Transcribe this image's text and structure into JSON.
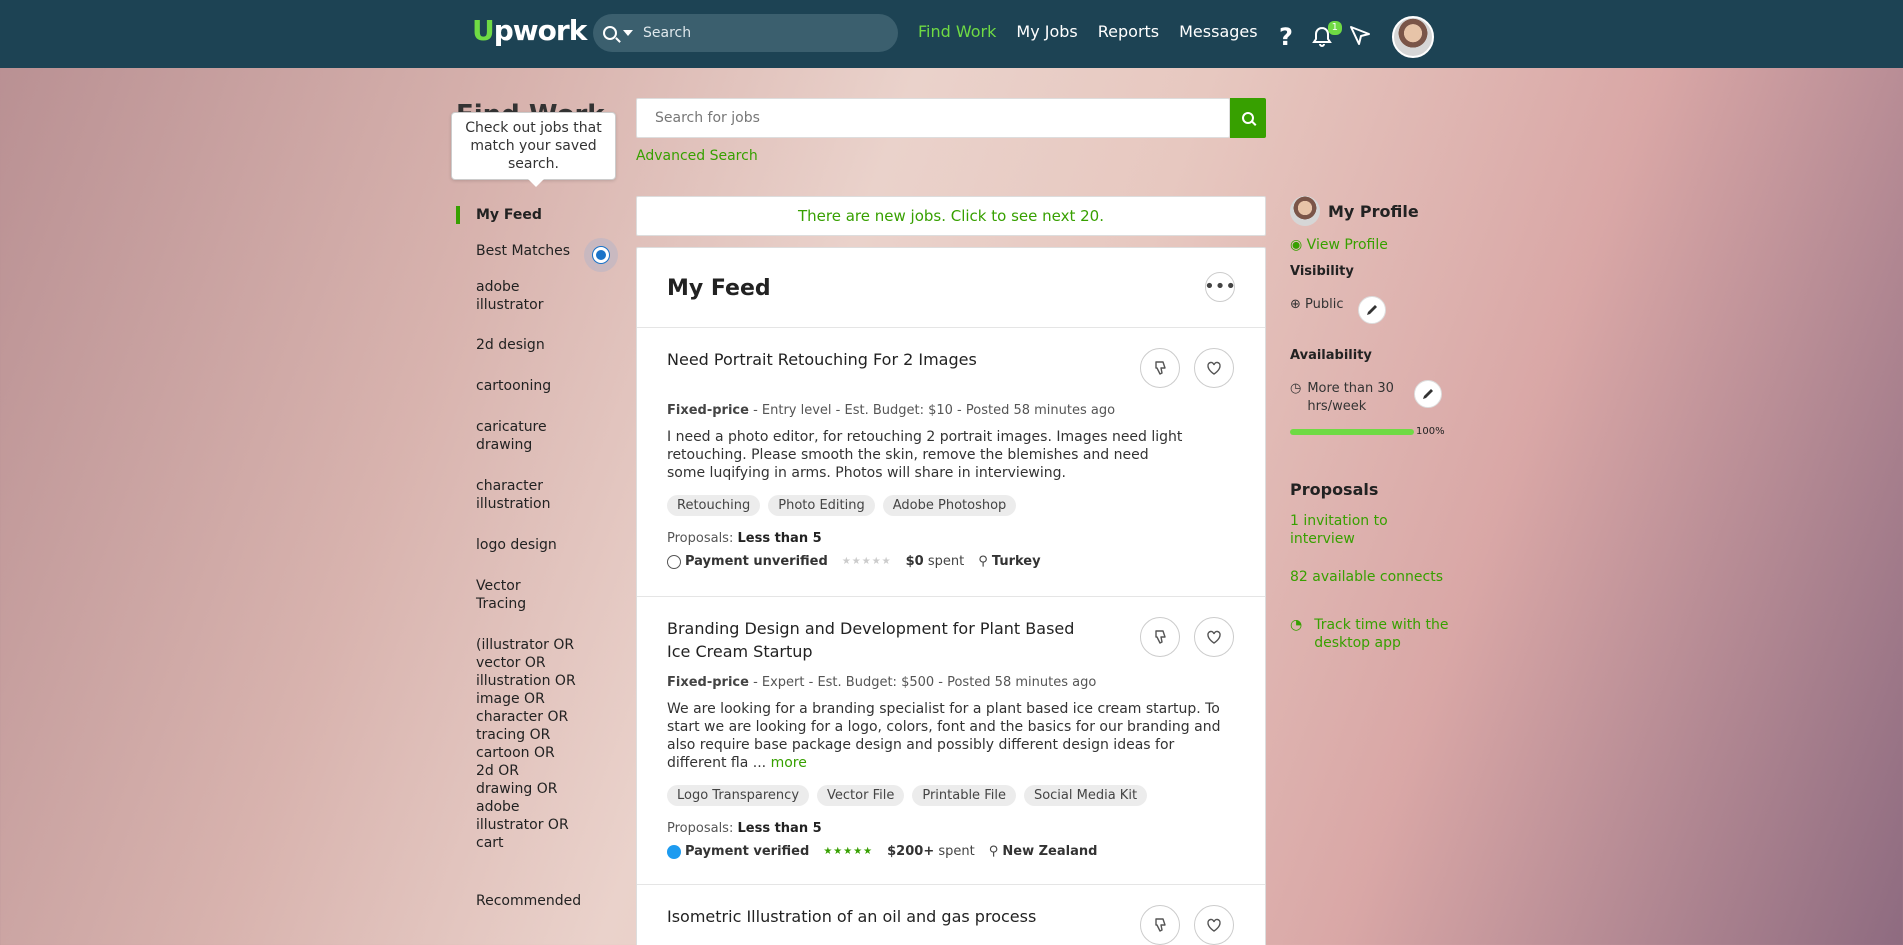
{
  "topbar": {
    "logo": "Upwork",
    "search_placeholder": "Search",
    "nav": [
      "Find Work",
      "My Jobs",
      "Reports",
      "Messages"
    ],
    "help": "?",
    "notification_count": "1"
  },
  "page": {
    "title": "Find Work",
    "tooltip": "Check out jobs that match your saved search.",
    "job_search_placeholder": "Search for jobs",
    "advanced_search": "Advanced Search",
    "new_jobs_banner": "There are new jobs. Click to see next 20.",
    "feed_title": "My Feed",
    "more_menu": "•••"
  },
  "leftnav": {
    "items": [
      "My Feed",
      "Best Matches",
      "adobe illustrator",
      "2d design",
      "cartooning",
      "caricature drawing",
      "character illustration",
      "logo design",
      "Vector Tracing",
      "(illustrator OR vector OR illustration OR image OR character OR tracing OR cartoon OR 2d OR drawing OR adobe illustrator OR cart",
      "Recommended"
    ]
  },
  "jobs": [
    {
      "title": "Need Portrait Retouching For 2 Images",
      "price_type": "Fixed-price",
      "meta": " - Entry level - Est. Budget: $10 - Posted 58 minutes ago",
      "description": "I need a photo editor, for retouching 2 portrait images. Images need light retouching. Please smooth the skin, remove the blemishes and need some luqifying in arms. Photos will share in interviewing.",
      "more": "",
      "tags": [
        "Retouching",
        "Photo Editing",
        "Adobe Photoshop"
      ],
      "proposals_label": "Proposals:",
      "proposals_value": "Less than 5",
      "payment": "Payment unverified",
      "stars": "★★★★★",
      "spent_value": "$0",
      "spent_label": "spent",
      "location": "Turkey"
    },
    {
      "title": "Branding Design and Development for Plant Based Ice Cream Startup",
      "price_type": "Fixed-price",
      "meta": " - Expert - Est. Budget: $500 - Posted 58 minutes ago",
      "description": "We are looking for a branding specialist for a plant based ice cream startup. To start we are looking for a logo, colors, font and the basics for our branding and also require base package design and possibly different design ideas for different fla ... ",
      "more": "more",
      "tags": [
        "Logo Transparency",
        "Vector File",
        "Printable File",
        "Social Media Kit"
      ],
      "proposals_label": "Proposals:",
      "proposals_value": "Less than 5",
      "payment": "Payment verified",
      "stars": "★★★★★",
      "spent_value": "$200+",
      "spent_label": "spent",
      "location": "New Zealand"
    },
    {
      "title": "Isometric Illustration of an oil and gas process"
    }
  ],
  "sidebar": {
    "profile_title": "My Profile",
    "view_profile": "View Profile",
    "visibility_heading": "Visibility",
    "visibility_value": "Public",
    "availability_heading": "Availability",
    "availability_value": "More than 30 hrs/week",
    "profile_completeness": 1.0,
    "completeness_label": "100%",
    "proposals_heading": "Proposals",
    "invitations": "1 invitation to interview",
    "connects": "82 available connects",
    "track_time": "Track time with the desktop app"
  },
  "colors": {
    "brand_green": "#37a000",
    "topbar": "#1d4354",
    "accent_green": "#6fda44"
  }
}
